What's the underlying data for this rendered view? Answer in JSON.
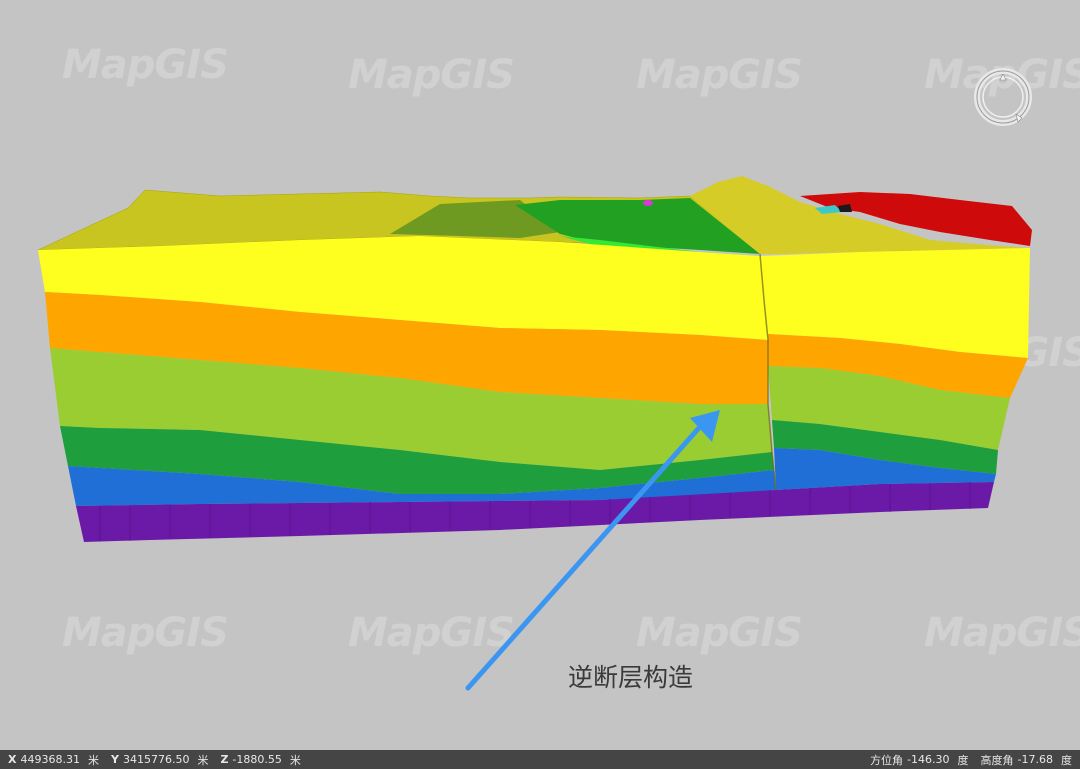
{
  "viewport": {
    "watermark_text": "MapGIS",
    "annotation_label": "逆断层构造",
    "compass_icon": "navigation-compass-icon",
    "colors": {
      "background": "#c4c4c4",
      "yellow_layer": "#ffff1f",
      "orange_layer": "#ffa500",
      "light_green_layer": "#9acd32",
      "green_layer": "#1e9e3c",
      "blue_layer": "#1f6fd6",
      "purple_base": "#6a1aa6",
      "surface_red": "#d40000",
      "arrow": "#3a96f0"
    }
  },
  "statusbar": {
    "x_label": "X",
    "x_value": "449368.31",
    "x_unit": "米",
    "y_label": "Y",
    "y_value": "3415776.50",
    "y_unit": "米",
    "z_label": "Z",
    "z_value": "-1880.55",
    "z_unit": "米",
    "azimuth_label": "方位角",
    "azimuth_value": "-146.30",
    "azimuth_unit": "度",
    "elevation_label": "高度角",
    "elevation_value": "-17.68",
    "elevation_unit": "度"
  }
}
